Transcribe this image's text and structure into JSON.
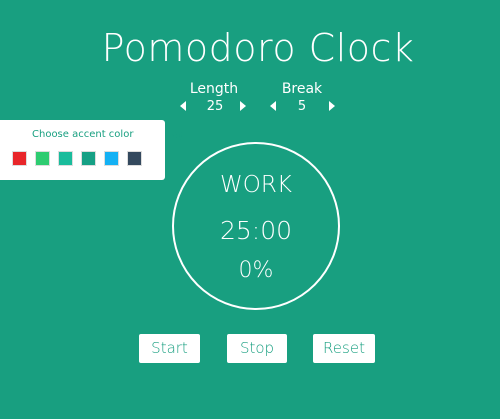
{
  "app": {
    "title": "Pomodoro Clock"
  },
  "controls": {
    "length": {
      "label": "Length",
      "value": "25"
    },
    "break": {
      "label": "Break",
      "value": "5"
    }
  },
  "accent_picker": {
    "title": "Choose accent color",
    "swatches": [
      "#e8262a",
      "#2ecc71",
      "#1abc9c",
      "#16a085",
      "#14b1f4",
      "#34495e"
    ]
  },
  "clock": {
    "mode": "WORK",
    "time": "25:00",
    "progress": "0%"
  },
  "buttons": {
    "start": "Start",
    "stop": "Stop",
    "reset": "Reset"
  },
  "colors": {
    "background": "#189f80",
    "foreground": "#ffffff"
  }
}
